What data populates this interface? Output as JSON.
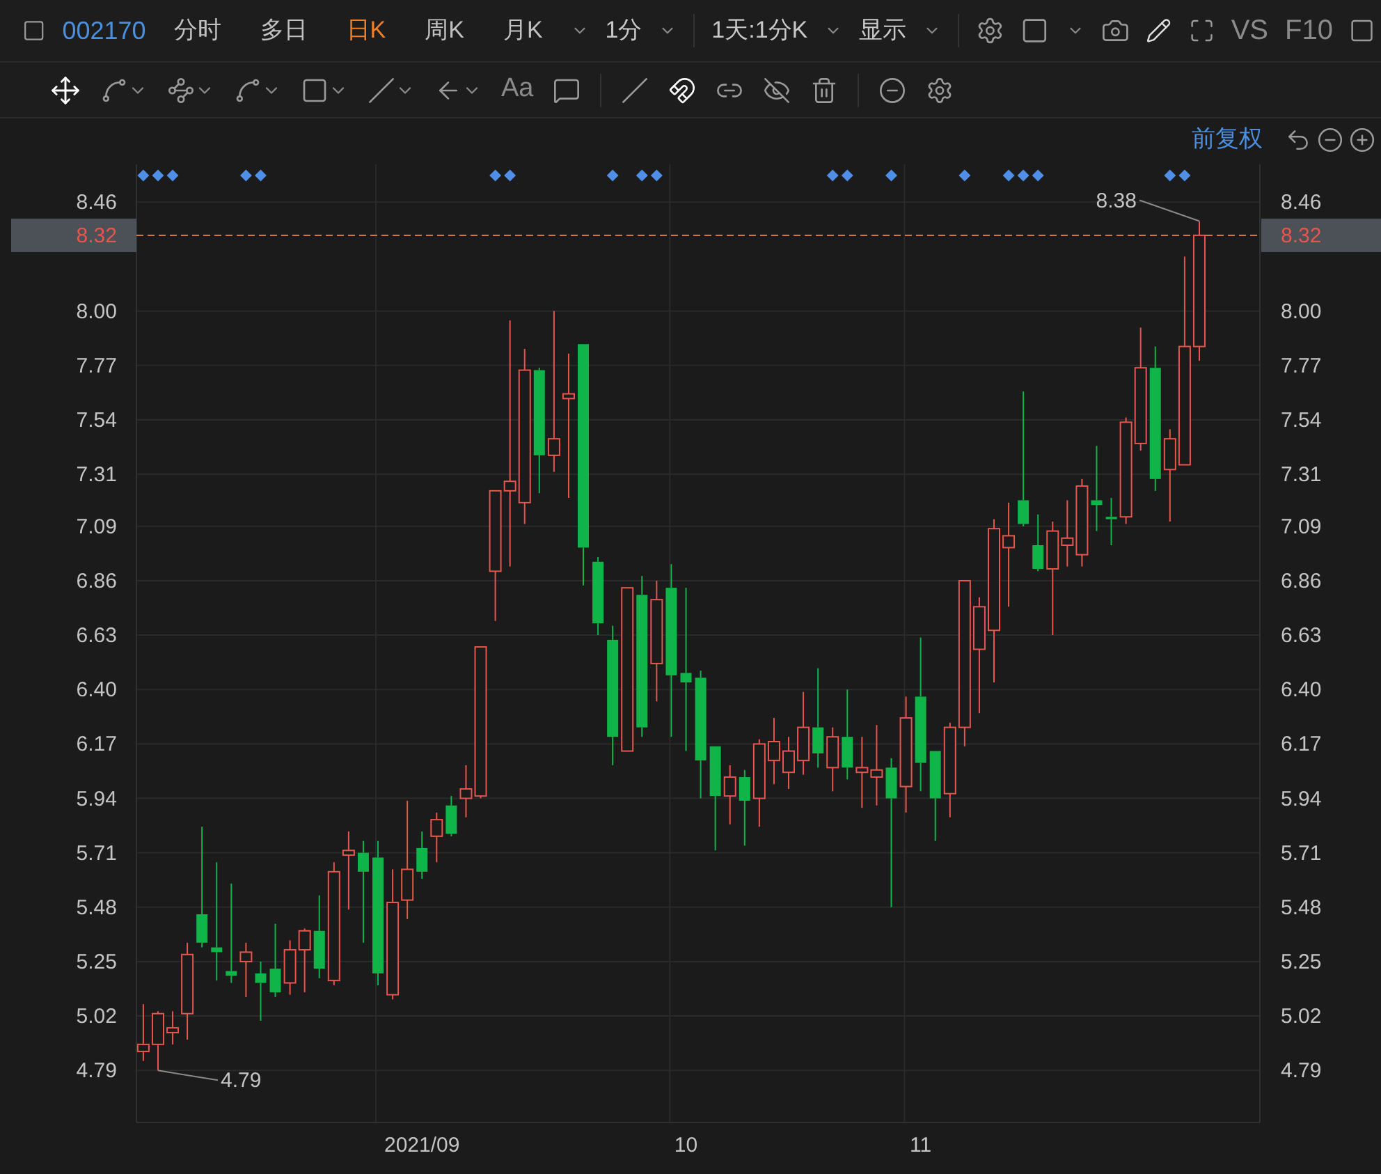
{
  "toolbar": {
    "stock_code": "002170",
    "periods": [
      {
        "label": "分时",
        "selected": false
      },
      {
        "label": "多日",
        "selected": false
      },
      {
        "label": "日K",
        "selected": true
      },
      {
        "label": "周K",
        "selected": false
      },
      {
        "label": "月K",
        "selected": false
      }
    ],
    "interval": "1分",
    "range": "1天:1分K",
    "display": "显示",
    "compare": "VS",
    "f10": "F10"
  },
  "drawing_tools": {
    "text_tool": "Aa"
  },
  "chart_header": {
    "adjustment": "前复权"
  },
  "chart": {
    "current_price": {
      "right_label": "8.32"
    },
    "event_markers": [
      true,
      true,
      true,
      false,
      false,
      false,
      false,
      true,
      true,
      false,
      false,
      false,
      false,
      false,
      false,
      false,
      false,
      false,
      false,
      false,
      false,
      false,
      false,
      false,
      true,
      true,
      false,
      false,
      false,
      false,
      false,
      false,
      true,
      false,
      true,
      true,
      false,
      false,
      false,
      false,
      false,
      false,
      false,
      false,
      false,
      false,
      false,
      true,
      true,
      false,
      false,
      true,
      false,
      false,
      false,
      false,
      true,
      false,
      false,
      true,
      true,
      true,
      false,
      false,
      false,
      false,
      false,
      false,
      false,
      false,
      true,
      true,
      false
    ],
    "chart_data": {
      "type": "candlestick",
      "grid": true,
      "categories": [
        null,
        null,
        null,
        null,
        null,
        null,
        null,
        null,
        null,
        null,
        null,
        null,
        null,
        null,
        null,
        null,
        null,
        null,
        null,
        "2021/09",
        null,
        null,
        null,
        null,
        null,
        null,
        null,
        null,
        null,
        null,
        null,
        null,
        null,
        null,
        null,
        null,
        null,
        "10",
        null,
        null,
        null,
        null,
        null,
        null,
        null,
        null,
        null,
        null,
        null,
        null,
        null,
        null,
        null,
        "11",
        null,
        null,
        null,
        null,
        null,
        null,
        null,
        null,
        null,
        null,
        null,
        null,
        null,
        null,
        null,
        null,
        null,
        null,
        null
      ],
      "ohlc": [
        [
          4.87,
          5.07,
          4.83,
          4.9
        ],
        [
          4.9,
          5.04,
          4.79,
          5.03
        ],
        [
          4.95,
          5.04,
          4.9,
          4.97
        ],
        [
          5.03,
          5.33,
          4.92,
          5.28
        ],
        [
          5.45,
          5.82,
          5.31,
          5.33
        ],
        [
          5.31,
          5.67,
          5.17,
          5.29
        ],
        [
          5.21,
          5.58,
          5.16,
          5.19
        ],
        [
          5.25,
          5.33,
          5.1,
          5.29
        ],
        [
          5.2,
          5.25,
          5.0,
          5.16
        ],
        [
          5.22,
          5.41,
          5.1,
          5.12
        ],
        [
          5.16,
          5.34,
          5.11,
          5.3
        ],
        [
          5.3,
          5.39,
          5.12,
          5.38
        ],
        [
          5.38,
          5.53,
          5.18,
          5.22
        ],
        [
          5.17,
          5.67,
          5.15,
          5.63
        ],
        [
          5.7,
          5.8,
          5.47,
          5.72
        ],
        [
          5.71,
          5.76,
          5.33,
          5.63
        ],
        [
          5.69,
          5.76,
          5.15,
          5.2
        ],
        [
          5.11,
          5.64,
          5.09,
          5.5
        ],
        [
          5.51,
          5.93,
          5.43,
          5.64
        ],
        [
          5.73,
          5.8,
          5.6,
          5.63
        ],
        [
          5.78,
          5.88,
          5.67,
          5.85
        ],
        [
          5.91,
          5.95,
          5.78,
          5.79
        ],
        [
          5.94,
          6.08,
          5.86,
          5.98
        ],
        [
          5.95,
          6.58,
          5.94,
          6.58
        ],
        [
          6.9,
          7.24,
          6.69,
          7.24
        ],
        [
          7.24,
          7.96,
          6.92,
          7.28
        ],
        [
          7.19,
          7.84,
          7.1,
          7.75
        ],
        [
          7.75,
          7.76,
          7.23,
          7.39
        ],
        [
          7.39,
          8.0,
          7.32,
          7.46
        ],
        [
          7.63,
          7.82,
          7.21,
          7.65
        ],
        [
          7.86,
          7.86,
          6.84,
          7.0
        ],
        [
          6.94,
          6.96,
          6.63,
          6.68
        ],
        [
          6.61,
          6.67,
          6.08,
          6.2
        ],
        [
          6.14,
          6.83,
          6.14,
          6.83
        ],
        [
          6.8,
          6.88,
          6.2,
          6.24
        ],
        [
          6.51,
          6.86,
          6.35,
          6.78
        ],
        [
          6.83,
          6.93,
          6.2,
          6.46
        ],
        [
          6.47,
          6.83,
          6.14,
          6.43
        ],
        [
          6.45,
          6.48,
          5.94,
          6.1
        ],
        [
          6.16,
          6.16,
          5.72,
          5.95
        ],
        [
          5.95,
          6.08,
          5.83,
          6.03
        ],
        [
          6.03,
          6.06,
          5.74,
          5.93
        ],
        [
          5.94,
          6.19,
          5.82,
          6.17
        ],
        [
          6.1,
          6.28,
          6.0,
          6.18
        ],
        [
          6.05,
          6.2,
          5.98,
          6.14
        ],
        [
          6.1,
          6.39,
          6.04,
          6.24
        ],
        [
          6.24,
          6.49,
          6.07,
          6.13
        ],
        [
          6.07,
          6.24,
          5.97,
          6.2
        ],
        [
          6.2,
          6.4,
          6.02,
          6.07
        ],
        [
          6.05,
          6.2,
          5.9,
          6.07
        ],
        [
          6.03,
          6.25,
          5.91,
          6.06
        ],
        [
          6.07,
          6.11,
          5.48,
          5.94
        ],
        [
          5.99,
          6.37,
          5.88,
          6.28
        ],
        [
          6.37,
          6.62,
          5.97,
          6.09
        ],
        [
          6.14,
          6.14,
          5.76,
          5.94
        ],
        [
          5.96,
          6.26,
          5.86,
          6.24
        ],
        [
          6.24,
          6.86,
          6.16,
          6.86
        ],
        [
          6.57,
          6.79,
          6.3,
          6.75
        ],
        [
          6.65,
          7.12,
          6.43,
          7.08
        ],
        [
          7.0,
          7.19,
          6.75,
          7.05
        ],
        [
          7.2,
          7.66,
          7.09,
          7.1
        ],
        [
          7.01,
          7.14,
          6.9,
          6.91
        ],
        [
          6.91,
          7.11,
          6.63,
          7.07
        ],
        [
          7.01,
          7.2,
          6.92,
          7.04
        ],
        [
          6.97,
          7.29,
          6.92,
          7.26
        ],
        [
          7.2,
          7.43,
          7.07,
          7.18
        ],
        [
          7.13,
          7.21,
          7.01,
          7.12
        ],
        [
          7.13,
          7.55,
          7.1,
          7.53
        ],
        [
          7.44,
          7.93,
          7.41,
          7.76
        ],
        [
          7.76,
          7.85,
          7.24,
          7.29
        ],
        [
          7.33,
          7.5,
          7.11,
          7.46
        ],
        [
          7.35,
          8.23,
          7.35,
          7.85
        ],
        [
          7.85,
          8.38,
          7.79,
          8.32
        ]
      ],
      "ylim": [
        4.57,
        8.62
      ],
      "yticks": [
        {
          "value": 8.46,
          "label": "8.46"
        },
        {
          "value": 8.0,
          "label": "8.00"
        },
        {
          "value": 7.77,
          "label": "7.77"
        },
        {
          "value": 7.54,
          "label": "7.54"
        },
        {
          "value": 7.31,
          "label": "7.31"
        },
        {
          "value": 7.09,
          "label": "7.09"
        },
        {
          "value": 6.86,
          "label": "6.86"
        },
        {
          "value": 6.63,
          "label": "6.63"
        },
        {
          "value": 6.4,
          "label": "6.40"
        },
        {
          "value": 6.17,
          "label": "6.17"
        },
        {
          "value": 5.94,
          "label": "5.94"
        },
        {
          "value": 5.71,
          "label": "5.71"
        },
        {
          "value": 5.48,
          "label": "5.48"
        },
        {
          "value": 5.25,
          "label": "5.25"
        },
        {
          "value": 5.02,
          "label": "5.02"
        },
        {
          "value": 4.79,
          "label": "4.79"
        }
      ],
      "ref_lines": [
        {
          "axis": "y",
          "value": 8.32,
          "label": "8.32",
          "color": "#d9743d"
        }
      ],
      "annotations": [
        {
          "text": "8.38"
        },
        {
          "text": "4.79"
        }
      ]
    }
  }
}
